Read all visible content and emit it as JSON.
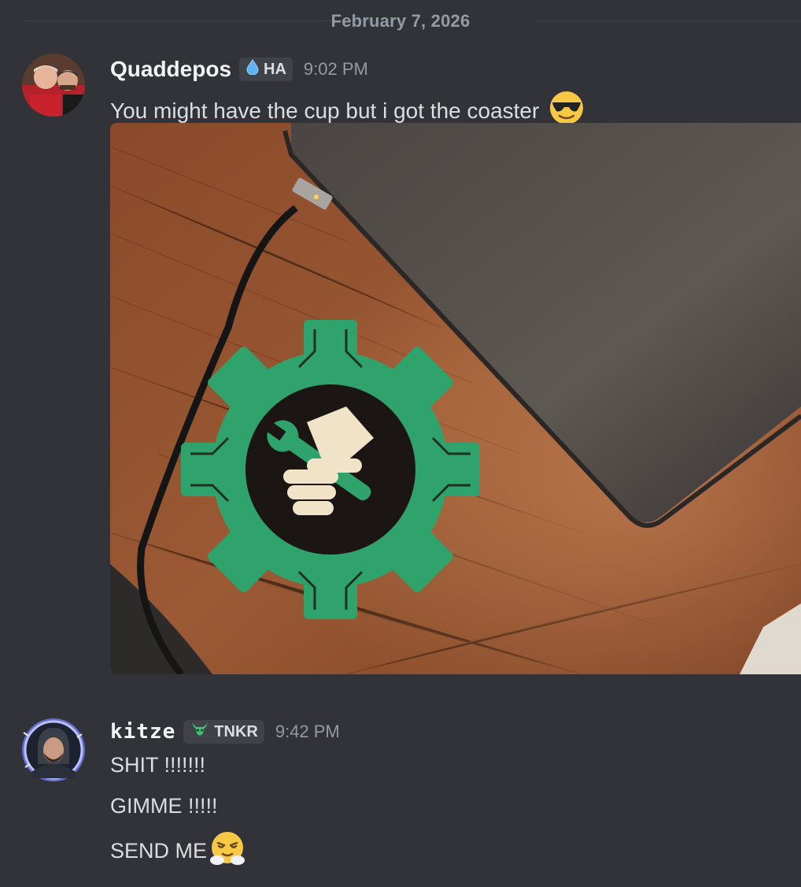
{
  "date_divider": "February 7, 2026",
  "messages": [
    {
      "username": "Quaddepos",
      "tag": "HA",
      "time": "9:02 PM",
      "text": "You might have the cup but i got the coaster",
      "emoji": "smiling-face-with-sunglasses"
    },
    {
      "username": "kitze",
      "tag": "TNKR",
      "time": "9:42 PM",
      "lines": [
        "SHIT !!!!!!!",
        "GIMME !!!!!",
        "SEND ME"
      ],
      "emoji": "face-with-steam-from-nose"
    }
  ],
  "colors": {
    "background": "#313338",
    "text": "#dbdee1",
    "muted": "#949ba4",
    "coaster_green": "#2fa36b"
  }
}
